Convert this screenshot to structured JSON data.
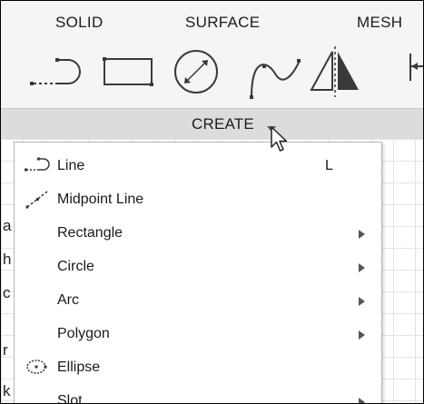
{
  "tabs": {
    "solid": "SOLID",
    "surface": "SURFACE",
    "mesh": "MESH"
  },
  "toolbar": {
    "icons": [
      "line-icon",
      "rectangle-icon",
      "circle-icon",
      "spline-icon",
      "mirror-icon",
      "dimension-icon"
    ]
  },
  "create_panel": {
    "label": "CREATE",
    "caret": "▾"
  },
  "menu": {
    "items": [
      {
        "label": "Line",
        "shortcut": "L",
        "submenu": false,
        "icon": "line-icon"
      },
      {
        "label": "Midpoint Line",
        "shortcut": "",
        "submenu": false,
        "icon": "midpoint-line-icon"
      },
      {
        "label": "Rectangle",
        "shortcut": "",
        "submenu": true,
        "icon": ""
      },
      {
        "label": "Circle",
        "shortcut": "",
        "submenu": true,
        "icon": ""
      },
      {
        "label": "Arc",
        "shortcut": "",
        "submenu": true,
        "icon": ""
      },
      {
        "label": "Polygon",
        "shortcut": "",
        "submenu": true,
        "icon": ""
      },
      {
        "label": "Ellipse",
        "shortcut": "",
        "submenu": false,
        "icon": "ellipse-icon"
      },
      {
        "label": "Slot",
        "shortcut": "",
        "submenu": true,
        "icon": ""
      }
    ]
  },
  "background_partial_letters": [
    "a",
    "h",
    "c",
    "r",
    "k"
  ],
  "colors": {
    "toolbar_bg": "#f5f5f5",
    "create_strip_bg": "#dcdcdc",
    "menu_bg": "#ffffff",
    "grid": "#e3e3e3",
    "icon_stroke": "#3a3a3a"
  }
}
